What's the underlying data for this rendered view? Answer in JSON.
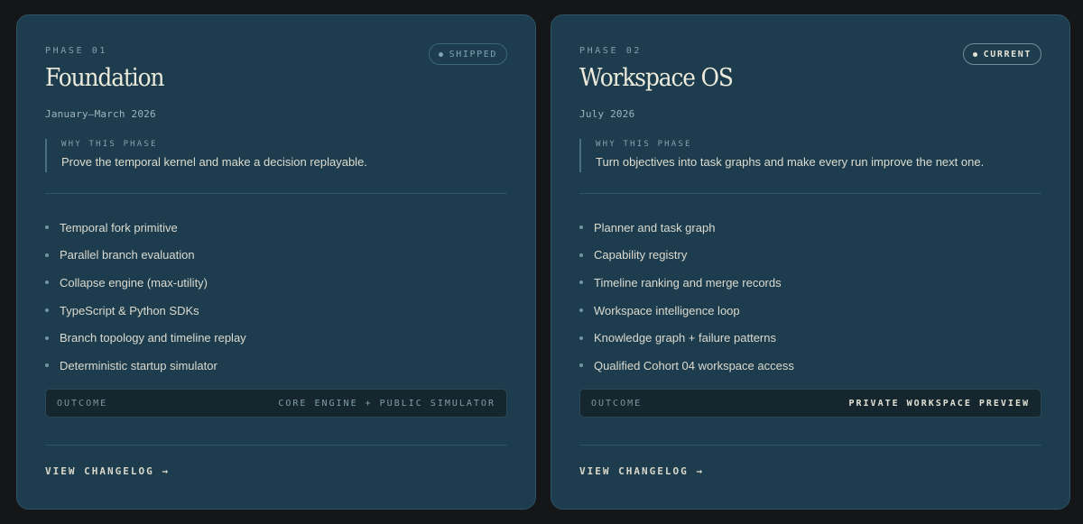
{
  "cards": [
    {
      "phase_label": "PHASE 01",
      "status": "SHIPPED",
      "title": "Foundation",
      "date": "January–March 2026",
      "why_label": "WHY THIS PHASE",
      "why_text": "Prove the temporal kernel and make a decision replayable.",
      "features": [
        "Temporal fork primitive",
        "Parallel branch evaluation",
        "Collapse engine (max-utility)",
        "TypeScript & Python SDKs",
        "Branch topology and timeline replay",
        "Deterministic startup simulator"
      ],
      "outcome_label": "OUTCOME",
      "outcome_value": "CORE ENGINE + PUBLIC SIMULATOR",
      "changelog_label": "VIEW CHANGELOG",
      "arrow": "→"
    },
    {
      "phase_label": "PHASE 02",
      "status": "CURRENT",
      "title": "Workspace OS",
      "date": "July 2026",
      "why_label": "WHY THIS PHASE",
      "why_text": "Turn objectives into task graphs and make every run improve the next one.",
      "features": [
        "Planner and task graph",
        "Capability registry",
        "Timeline ranking and merge records",
        "Workspace intelligence loop",
        "Knowledge graph + failure patterns",
        "Qualified Cohort 04 workspace access"
      ],
      "outcome_label": "OUTCOME",
      "outcome_value": "PRIVATE WORKSPACE PREVIEW",
      "changelog_label": "VIEW CHANGELOG",
      "arrow": "→"
    }
  ],
  "colors": {
    "background": "#141617",
    "card": "#1d3d4e",
    "text": "#eeebdc",
    "muted": "#86a0ad"
  },
  "icons": {
    "status_dot": "status-dot-icon",
    "bullet": "bullet-icon",
    "arrow": "arrow-right-icon"
  }
}
